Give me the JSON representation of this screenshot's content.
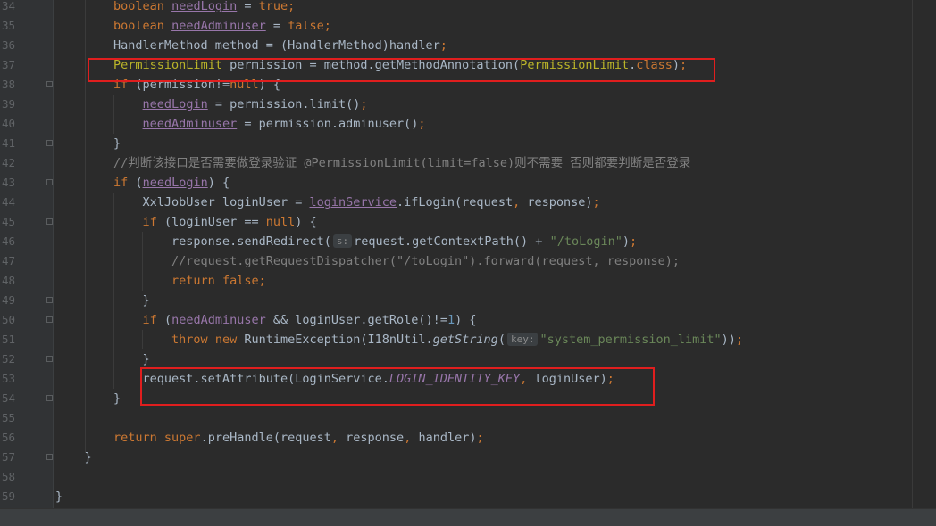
{
  "editor": {
    "lines": [
      {
        "num": "34",
        "tokens": [
          {
            "t": "        "
          },
          {
            "t": "boolean ",
            "c": "k"
          },
          {
            "t": "needLogin",
            "c": "f"
          },
          {
            "t": " = "
          },
          {
            "t": "true",
            "c": "k"
          },
          {
            "t": ";",
            "c": "k"
          }
        ]
      },
      {
        "num": "35",
        "tokens": [
          {
            "t": "        "
          },
          {
            "t": "boolean ",
            "c": "k"
          },
          {
            "t": "needAdminuser",
            "c": "f"
          },
          {
            "t": " = "
          },
          {
            "t": "false",
            "c": "k"
          },
          {
            "t": ";",
            "c": "k"
          }
        ]
      },
      {
        "num": "36",
        "tokens": [
          {
            "t": "        HandlerMethod method = (HandlerMethod)handler"
          },
          {
            "t": ";",
            "c": "k"
          }
        ]
      },
      {
        "num": "37",
        "tokens": [
          {
            "t": "        "
          },
          {
            "t": "PermissionLimit",
            "c": "a"
          },
          {
            "t": " permission = method.getMethodAnnotation("
          },
          {
            "t": "PermissionLimit",
            "c": "a"
          },
          {
            "t": "."
          },
          {
            "t": "class",
            "c": "k"
          },
          {
            "t": ")"
          },
          {
            "t": ";",
            "c": "k"
          }
        ]
      },
      {
        "num": "38",
        "tokens": [
          {
            "t": "        "
          },
          {
            "t": "if ",
            "c": "k"
          },
          {
            "t": "(permission!="
          },
          {
            "t": "null",
            "c": "k"
          },
          {
            "t": ") {"
          }
        ]
      },
      {
        "num": "39",
        "tokens": [
          {
            "t": "            "
          },
          {
            "t": "needLogin",
            "c": "f"
          },
          {
            "t": " = permission.limit()"
          },
          {
            "t": ";",
            "c": "k"
          }
        ]
      },
      {
        "num": "40",
        "tokens": [
          {
            "t": "            "
          },
          {
            "t": "needAdminuser",
            "c": "f"
          },
          {
            "t": " = permission.adminuser()"
          },
          {
            "t": ";",
            "c": "k"
          }
        ]
      },
      {
        "num": "41",
        "tokens": [
          {
            "t": "        }"
          }
        ]
      },
      {
        "num": "42",
        "tokens": [
          {
            "t": "        "
          },
          {
            "t": "//判断该接口是否需要做登录验证 @PermissionLimit(limit=false)则不需要 否则都要判断是否登录",
            "c": "c"
          }
        ]
      },
      {
        "num": "43",
        "tokens": [
          {
            "t": "        "
          },
          {
            "t": "if ",
            "c": "k"
          },
          {
            "t": "("
          },
          {
            "t": "needLogin",
            "c": "f"
          },
          {
            "t": ") {"
          }
        ]
      },
      {
        "num": "44",
        "tokens": [
          {
            "t": "            XxlJobUser loginUser = "
          },
          {
            "t": "loginService",
            "c": "f"
          },
          {
            "t": ".ifLogin(request"
          },
          {
            "t": ", ",
            "c": "k"
          },
          {
            "t": "response)"
          },
          {
            "t": ";",
            "c": "k"
          }
        ]
      },
      {
        "num": "45",
        "tokens": [
          {
            "t": "            "
          },
          {
            "t": "if ",
            "c": "k"
          },
          {
            "t": "(loginUser == "
          },
          {
            "t": "null",
            "c": "k"
          },
          {
            "t": ") {"
          }
        ]
      },
      {
        "num": "46",
        "tokens": [
          {
            "t": "                response.sendRedirect("
          },
          {
            "t": "s:",
            "c": "hint"
          },
          {
            "t": "request.getContextPath() + "
          },
          {
            "t": "\"/toLogin\"",
            "c": "s"
          },
          {
            "t": ")"
          },
          {
            "t": ";",
            "c": "k"
          }
        ]
      },
      {
        "num": "47",
        "tokens": [
          {
            "t": "                "
          },
          {
            "t": "//request.getRequestDispatcher(\"/toLogin\").forward(request, response);",
            "c": "c"
          }
        ]
      },
      {
        "num": "48",
        "tokens": [
          {
            "t": "                "
          },
          {
            "t": "return false;",
            "c": "k"
          }
        ]
      },
      {
        "num": "49",
        "tokens": [
          {
            "t": "            }"
          }
        ]
      },
      {
        "num": "50",
        "tokens": [
          {
            "t": "            "
          },
          {
            "t": "if ",
            "c": "k"
          },
          {
            "t": "("
          },
          {
            "t": "needAdminuser",
            "c": "f"
          },
          {
            "t": " && loginUser.getRole()!="
          },
          {
            "t": "1",
            "c": "n"
          },
          {
            "t": ") {"
          }
        ]
      },
      {
        "num": "51",
        "tokens": [
          {
            "t": "                "
          },
          {
            "t": "throw new ",
            "c": "k"
          },
          {
            "t": "RuntimeException(I18nUtil."
          },
          {
            "t": "getString",
            "c": "m"
          },
          {
            "t": "("
          },
          {
            "t": "key:",
            "c": "hint"
          },
          {
            "t": "\"system_permission_limit\"",
            "c": "s"
          },
          {
            "t": "))"
          },
          {
            "t": ";",
            "c": "k"
          }
        ]
      },
      {
        "num": "52",
        "tokens": [
          {
            "t": "            }"
          }
        ]
      },
      {
        "num": "53",
        "tokens": [
          {
            "t": "            request.setAttribute(LoginService."
          },
          {
            "t": "LOGIN_IDENTITY_KEY",
            "c": "st"
          },
          {
            "t": ", ",
            "c": "k"
          },
          {
            "t": "loginUser)"
          },
          {
            "t": ";",
            "c": "k"
          }
        ]
      },
      {
        "num": "54",
        "tokens": [
          {
            "t": "        }"
          }
        ]
      },
      {
        "num": "55",
        "tokens": [
          {
            "t": ""
          }
        ]
      },
      {
        "num": "56",
        "tokens": [
          {
            "t": "        "
          },
          {
            "t": "return super",
            "c": "k"
          },
          {
            "t": ".preHandle(request"
          },
          {
            "t": ", ",
            "c": "k"
          },
          {
            "t": "response"
          },
          {
            "t": ", ",
            "c": "k"
          },
          {
            "t": "handler)"
          },
          {
            "t": ";",
            "c": "k"
          }
        ]
      },
      {
        "num": "57",
        "tokens": [
          {
            "t": "    }"
          }
        ]
      },
      {
        "num": "58",
        "tokens": [
          {
            "t": ""
          }
        ]
      },
      {
        "num": "59",
        "tokens": [
          {
            "t": "}"
          }
        ]
      }
    ]
  },
  "annotations": {
    "highlight_color": "#e01e1e",
    "boxes": [
      "line-37",
      "line-53"
    ]
  },
  "colors": {
    "background": "#2b2b2b",
    "keyword": "#cc7832",
    "string": "#6a8759",
    "comment": "#808080",
    "field": "#9876aa",
    "annotation": "#bbb529",
    "number": "#6897bb",
    "text": "#a9b7c6"
  }
}
